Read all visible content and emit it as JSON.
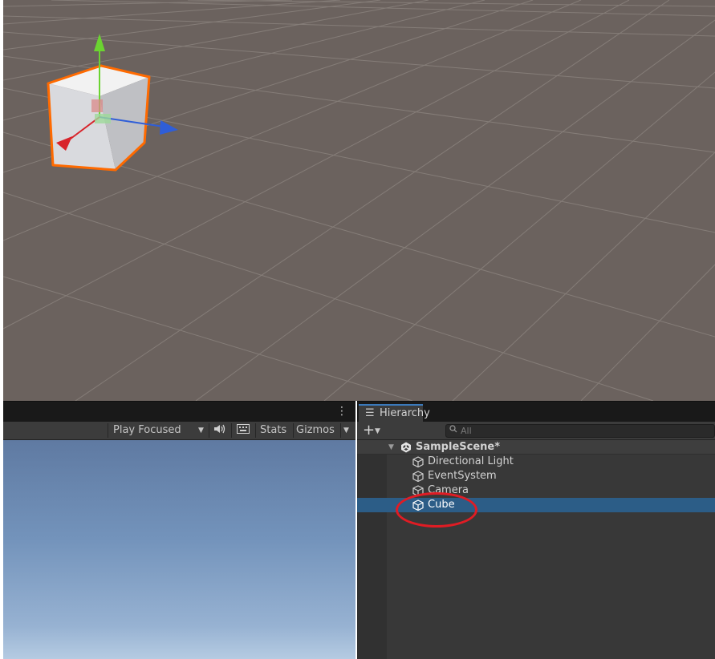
{
  "game_view": {
    "more_icon": "vertical-ellipsis-icon",
    "toolbar": {
      "play_focused_label": "Play Focused",
      "dropdown_icon": "caret-down-icon",
      "audio_icon": "speaker-icon",
      "keyboard_icon": "keyboard-icon",
      "stats_label": "Stats",
      "gizmos_label": "Gizmos"
    }
  },
  "hierarchy": {
    "tab_label": "Hierarchy",
    "tab_icon": "list-icon",
    "add_icon": "plus-icon",
    "search": {
      "placeholder": "All",
      "value": ""
    },
    "scene": {
      "label": "SampleScene*",
      "icon": "unity-logo-icon",
      "expanded": true
    },
    "items": [
      {
        "label": "Directional Light",
        "icon": "cube-icon",
        "selected": false
      },
      {
        "label": "EventSystem",
        "icon": "cube-icon",
        "selected": false
      },
      {
        "label": "Camera",
        "icon": "cube-icon",
        "selected": false
      },
      {
        "label": "Cube",
        "icon": "cube-icon",
        "selected": true
      }
    ]
  },
  "colors": {
    "selection": "#2c5d87",
    "annotation_circle": "#e01c24",
    "selected_outline": "#ff6a00",
    "scene_ground": "#6b625e",
    "gizmo_x": "#d8232a",
    "gizmo_y": "#6bd431",
    "gizmo_z": "#2f5ed8"
  }
}
